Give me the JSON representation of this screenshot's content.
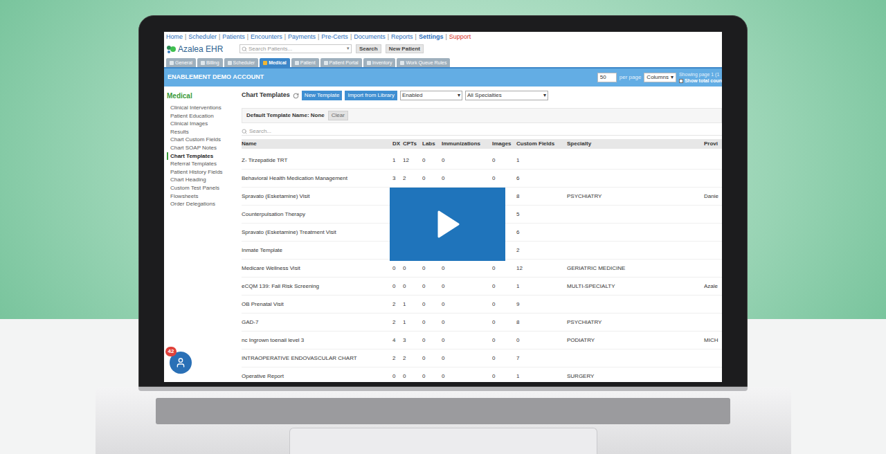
{
  "nav": {
    "separator": "|",
    "links": [
      {
        "label": "Home",
        "kind": "link"
      },
      {
        "label": "Scheduler",
        "kind": "link"
      },
      {
        "label": "Patients",
        "kind": "link"
      },
      {
        "label": "Encounters",
        "kind": "link"
      },
      {
        "label": "Payments",
        "kind": "link"
      },
      {
        "label": "Pre-Certs",
        "kind": "link"
      },
      {
        "label": "Documents",
        "kind": "link"
      },
      {
        "label": "Reports",
        "kind": "link"
      },
      {
        "label": "Settings",
        "kind": "bold"
      },
      {
        "label": "Support",
        "kind": "alert"
      }
    ]
  },
  "logo": "Azalea EHR",
  "patient_search": {
    "placeholder": "Search Patients...",
    "caret": "▾",
    "button": "Search",
    "new_button": "New Patient"
  },
  "tabs": [
    {
      "label": "General",
      "selected": false
    },
    {
      "label": "Billing",
      "selected": false
    },
    {
      "label": "Scheduler",
      "selected": false
    },
    {
      "label": "Medical",
      "selected": true
    },
    {
      "label": "Patient",
      "selected": false
    },
    {
      "label": "Patient Portal",
      "selected": false
    },
    {
      "label": "Inventory",
      "selected": false
    },
    {
      "label": "Work Queue Rules",
      "selected": false
    }
  ],
  "account_bar": {
    "title": "ENABLEMENT DEMO ACCOUNT",
    "per_page_value": "50",
    "per_page_label": "per page",
    "columns": "Columns",
    "caret": "▾",
    "showing": "Showing page 1 (1",
    "show_total": "Show total coun",
    "show_total_checked": false
  },
  "sidebar": {
    "title": "Medical",
    "items": [
      {
        "label": "Clinical Interventions",
        "selected": false
      },
      {
        "label": "Patient Education",
        "selected": false
      },
      {
        "label": "Clinical Images",
        "selected": false
      },
      {
        "label": "Results",
        "selected": false
      },
      {
        "label": "Chart Custom Fields",
        "selected": false
      },
      {
        "label": "Chart SOAP Notes",
        "selected": false
      },
      {
        "label": "Chart Templates",
        "selected": true
      },
      {
        "label": "Referral Templates",
        "selected": false
      },
      {
        "label": "Patient History Fields",
        "selected": false
      },
      {
        "label": "Chart Heading",
        "selected": false
      },
      {
        "label": "Custom Test Panels",
        "selected": false
      },
      {
        "label": "Flowsheets",
        "selected": false
      },
      {
        "label": "Order Delegations",
        "selected": false
      }
    ]
  },
  "toolbar": {
    "title": "Chart Templates",
    "new_button": "New Template",
    "import_button": "Import from Library",
    "status": "Enabled",
    "specialty": "All Specialties",
    "caret": "▾"
  },
  "default_template": {
    "label": "Default Template Name: None",
    "clear": "Clear"
  },
  "table_search": {
    "placeholder": "Search..."
  },
  "table": {
    "columns": [
      "Name",
      "DX",
      "CPTs",
      "Labs",
      "Immunizations",
      "Images",
      "Custom Fields",
      "Specialty",
      "Provi"
    ],
    "rows": [
      {
        "cells": [
          "Z- Tirzepatide TRT",
          "1",
          "12",
          "0",
          "0",
          "0",
          "1",
          "",
          ""
        ]
      },
      {
        "cells": [
          "Behavioral Health Medication Management",
          "3",
          "2",
          "0",
          "0",
          "0",
          "6",
          "",
          ""
        ]
      },
      {
        "cells": [
          "Spravato (Esketamine) Visit",
          "",
          "",
          "",
          "",
          "",
          "8",
          "PSYCHIATRY",
          "Danie"
        ]
      },
      {
        "cells": [
          "Counterpulsation Therapy",
          "",
          "",
          "",
          "",
          "",
          "5",
          "",
          ""
        ]
      },
      {
        "cells": [
          "Spravato (Esketamine) Treatment Visit",
          "",
          "",
          "",
          "",
          "",
          "6",
          "",
          ""
        ]
      },
      {
        "cells": [
          "Inmate Template",
          "",
          "",
          "",
          "",
          "",
          "2",
          "",
          ""
        ]
      },
      {
        "cells": [
          "Medicare Wellness Visit",
          "0",
          "0",
          "0",
          "0",
          "0",
          "12",
          "GERIATRIC MEDICINE",
          ""
        ]
      },
      {
        "cells": [
          "eCQM 139: Fall Risk Screening",
          "0",
          "0",
          "0",
          "0",
          "0",
          "1",
          "MULTI-SPECIALTY",
          "Azale"
        ]
      },
      {
        "cells": [
          "OB Prenatal Visit",
          "2",
          "1",
          "0",
          "0",
          "0",
          "9",
          "",
          ""
        ]
      },
      {
        "cells": [
          "GAD-7",
          "2",
          "1",
          "0",
          "0",
          "0",
          "8",
          "PSYCHIATRY",
          ""
        ]
      },
      {
        "cells": [
          "nc Ingrown toenail level 3",
          "4",
          "3",
          "0",
          "0",
          "0",
          "0",
          "PODIATRY",
          "MICH"
        ]
      },
      {
        "cells": [
          "INTRAOPERATIVE ENDOVASCULAR CHART",
          "2",
          "2",
          "0",
          "0",
          "0",
          "7",
          "",
          ""
        ]
      },
      {
        "cells": [
          "Operative Report",
          "0",
          "0",
          "0",
          "0",
          "0",
          "1",
          "SURGERY",
          ""
        ]
      }
    ]
  },
  "notification": {
    "count": "42"
  }
}
